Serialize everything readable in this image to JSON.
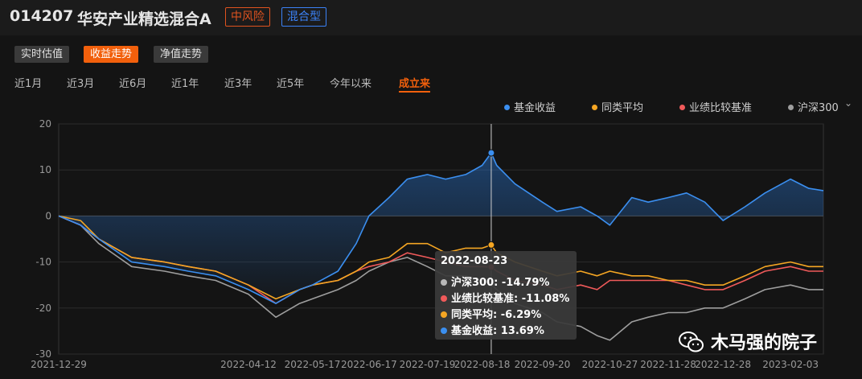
{
  "header": {
    "code": "014207",
    "name": "华安产业精选混合A",
    "risk_tag": "中风险",
    "type_tag": "混合型"
  },
  "views": [
    "实时估值",
    "收益走势",
    "净值走势"
  ],
  "active_view": 1,
  "ranges": [
    "近1月",
    "近3月",
    "近6月",
    "近1年",
    "近3年",
    "近5年",
    "今年以来",
    "成立来"
  ],
  "active_range": 7,
  "legend": [
    {
      "label": "基金收益",
      "color": "#3b8ff0"
    },
    {
      "label": "同类平均",
      "color": "#f5a623"
    },
    {
      "label": "业绩比较基准",
      "color": "#f05a5a"
    },
    {
      "label": "沪深300",
      "color": "#9e9e9e"
    }
  ],
  "legend_caret": "⌄",
  "tooltip": {
    "date": "2022-08-23",
    "rows": [
      {
        "label": "沪深300:",
        "value": "-14.79%",
        "color": "#b9b9b9"
      },
      {
        "label": "业绩比较基准:",
        "value": "-11.08%",
        "color": "#f05a5a"
      },
      {
        "label": "同类平均:",
        "value": "-6.29%",
        "color": "#f5a623"
      },
      {
        "label": "基金收益:",
        "value": "13.69%",
        "color": "#3b8ff0"
      }
    ]
  },
  "watermark": "木马强的院子",
  "chart_data": {
    "type": "line",
    "ylim": [
      -30,
      20
    ],
    "yticks": [
      20,
      10,
      0,
      -10,
      -20,
      -30
    ],
    "xticklabels": [
      "2021-12-29",
      "2022-04-12",
      "2022-05-17",
      "2022-06-17",
      "2022-07-19",
      "2022-08-18",
      "2022-09-20",
      "2022-10-27",
      "2022-11-28",
      "2022-12-28",
      "2023-02-03"
    ],
    "x_start": "2021-12-29",
    "x_end": "2023-02-21",
    "crosshair_date": "2022-08-23",
    "series": [
      {
        "name": "基金收益",
        "color": "#3b8ff0",
        "points": [
          [
            "2021-12-29",
            0
          ],
          [
            "2022-01-10",
            -2
          ],
          [
            "2022-01-20",
            -5
          ],
          [
            "2022-02-07",
            -10
          ],
          [
            "2022-02-25",
            -11
          ],
          [
            "2022-03-10",
            -12
          ],
          [
            "2022-03-25",
            -13
          ],
          [
            "2022-04-12",
            -16
          ],
          [
            "2022-04-27",
            -19
          ],
          [
            "2022-05-10",
            -16
          ],
          [
            "2022-05-17",
            -15
          ],
          [
            "2022-05-31",
            -12
          ],
          [
            "2022-06-10",
            -6
          ],
          [
            "2022-06-17",
            0
          ],
          [
            "2022-06-28",
            4
          ],
          [
            "2022-07-08",
            8
          ],
          [
            "2022-07-19",
            9
          ],
          [
            "2022-07-29",
            8
          ],
          [
            "2022-08-09",
            9
          ],
          [
            "2022-08-18",
            11
          ],
          [
            "2022-08-23",
            13.7
          ],
          [
            "2022-08-26",
            11
          ],
          [
            "2022-09-05",
            7
          ],
          [
            "2022-09-20",
            3
          ],
          [
            "2022-09-28",
            1
          ],
          [
            "2022-10-11",
            2
          ],
          [
            "2022-10-20",
            0
          ],
          [
            "2022-10-27",
            -2
          ],
          [
            "2022-11-08",
            4
          ],
          [
            "2022-11-17",
            3
          ],
          [
            "2022-11-28",
            4
          ],
          [
            "2022-12-08",
            5
          ],
          [
            "2022-12-18",
            3
          ],
          [
            "2022-12-28",
            -1
          ],
          [
            "2023-01-09",
            2
          ],
          [
            "2023-01-20",
            5
          ],
          [
            "2023-02-03",
            8
          ],
          [
            "2023-02-13",
            6
          ],
          [
            "2023-02-21",
            5.5
          ]
        ]
      },
      {
        "name": "同类平均",
        "color": "#f5a623",
        "points": [
          [
            "2021-12-29",
            0
          ],
          [
            "2022-01-10",
            -1
          ],
          [
            "2022-01-20",
            -5
          ],
          [
            "2022-02-07",
            -9
          ],
          [
            "2022-02-25",
            -10
          ],
          [
            "2022-03-10",
            -11
          ],
          [
            "2022-03-25",
            -12
          ],
          [
            "2022-04-12",
            -15
          ],
          [
            "2022-04-27",
            -18
          ],
          [
            "2022-05-10",
            -16
          ],
          [
            "2022-05-17",
            -15
          ],
          [
            "2022-05-31",
            -14
          ],
          [
            "2022-06-10",
            -12
          ],
          [
            "2022-06-17",
            -10
          ],
          [
            "2022-06-28",
            -9
          ],
          [
            "2022-07-08",
            -6
          ],
          [
            "2022-07-19",
            -6
          ],
          [
            "2022-07-29",
            -8
          ],
          [
            "2022-08-09",
            -7
          ],
          [
            "2022-08-18",
            -7
          ],
          [
            "2022-08-23",
            -6.3
          ],
          [
            "2022-08-26",
            -8
          ],
          [
            "2022-09-05",
            -10
          ],
          [
            "2022-09-20",
            -12
          ],
          [
            "2022-09-28",
            -13
          ],
          [
            "2022-10-11",
            -12
          ],
          [
            "2022-10-20",
            -13
          ],
          [
            "2022-10-27",
            -12
          ],
          [
            "2022-11-08",
            -13
          ],
          [
            "2022-11-17",
            -13
          ],
          [
            "2022-11-28",
            -14
          ],
          [
            "2022-12-08",
            -14
          ],
          [
            "2022-12-18",
            -15
          ],
          [
            "2022-12-28",
            -15
          ],
          [
            "2023-01-09",
            -13
          ],
          [
            "2023-01-20",
            -11
          ],
          [
            "2023-02-03",
            -10
          ],
          [
            "2023-02-13",
            -11
          ],
          [
            "2023-02-21",
            -11
          ]
        ]
      },
      {
        "name": "业绩比较基准",
        "color": "#f05a5a",
        "points": [
          [
            "2021-12-29",
            0
          ],
          [
            "2022-01-10",
            -2
          ],
          [
            "2022-01-20",
            -5
          ],
          [
            "2022-02-07",
            -9
          ],
          [
            "2022-02-25",
            -10
          ],
          [
            "2022-03-10",
            -11
          ],
          [
            "2022-03-25",
            -12
          ],
          [
            "2022-04-12",
            -15
          ],
          [
            "2022-04-27",
            -19
          ],
          [
            "2022-05-10",
            -16
          ],
          [
            "2022-05-17",
            -15
          ],
          [
            "2022-05-31",
            -14
          ],
          [
            "2022-06-10",
            -12
          ],
          [
            "2022-06-17",
            -11
          ],
          [
            "2022-06-28",
            -10
          ],
          [
            "2022-07-08",
            -8
          ],
          [
            "2022-07-19",
            -9
          ],
          [
            "2022-07-29",
            -10
          ],
          [
            "2022-08-09",
            -11
          ],
          [
            "2022-08-18",
            -11
          ],
          [
            "2022-08-23",
            -11.1
          ],
          [
            "2022-08-26",
            -12
          ],
          [
            "2022-09-05",
            -14
          ],
          [
            "2022-09-20",
            -15
          ],
          [
            "2022-09-28",
            -16
          ],
          [
            "2022-10-11",
            -15
          ],
          [
            "2022-10-20",
            -16
          ],
          [
            "2022-10-27",
            -14
          ],
          [
            "2022-11-08",
            -14
          ],
          [
            "2022-11-17",
            -14
          ],
          [
            "2022-11-28",
            -14
          ],
          [
            "2022-12-08",
            -15
          ],
          [
            "2022-12-18",
            -16
          ],
          [
            "2022-12-28",
            -16
          ],
          [
            "2023-01-09",
            -14
          ],
          [
            "2023-01-20",
            -12
          ],
          [
            "2023-02-03",
            -11
          ],
          [
            "2023-02-13",
            -12
          ],
          [
            "2023-02-21",
            -12
          ]
        ]
      },
      {
        "name": "沪深300",
        "color": "#9e9e9e",
        "points": [
          [
            "2021-12-29",
            0
          ],
          [
            "2022-01-10",
            -2
          ],
          [
            "2022-01-20",
            -6
          ],
          [
            "2022-02-07",
            -11
          ],
          [
            "2022-02-25",
            -12
          ],
          [
            "2022-03-10",
            -13
          ],
          [
            "2022-03-25",
            -14
          ],
          [
            "2022-04-12",
            -17
          ],
          [
            "2022-04-27",
            -22
          ],
          [
            "2022-05-10",
            -19
          ],
          [
            "2022-05-17",
            -18
          ],
          [
            "2022-05-31",
            -16
          ],
          [
            "2022-06-10",
            -14
          ],
          [
            "2022-06-17",
            -12
          ],
          [
            "2022-06-28",
            -10
          ],
          [
            "2022-07-08",
            -9
          ],
          [
            "2022-07-19",
            -11
          ],
          [
            "2022-07-29",
            -13
          ],
          [
            "2022-08-09",
            -13
          ],
          [
            "2022-08-18",
            -14
          ],
          [
            "2022-08-23",
            -14.8
          ],
          [
            "2022-08-26",
            -16
          ],
          [
            "2022-09-05",
            -19
          ],
          [
            "2022-09-20",
            -21
          ],
          [
            "2022-09-28",
            -23
          ],
          [
            "2022-10-11",
            -24
          ],
          [
            "2022-10-20",
            -26
          ],
          [
            "2022-10-27",
            -27
          ],
          [
            "2022-11-08",
            -23
          ],
          [
            "2022-11-17",
            -22
          ],
          [
            "2022-11-28",
            -21
          ],
          [
            "2022-12-08",
            -21
          ],
          [
            "2022-12-18",
            -20
          ],
          [
            "2022-12-28",
            -20
          ],
          [
            "2023-01-09",
            -18
          ],
          [
            "2023-01-20",
            -16
          ],
          [
            "2023-02-03",
            -15
          ],
          [
            "2023-02-13",
            -16
          ],
          [
            "2023-02-21",
            -16
          ]
        ]
      }
    ]
  }
}
